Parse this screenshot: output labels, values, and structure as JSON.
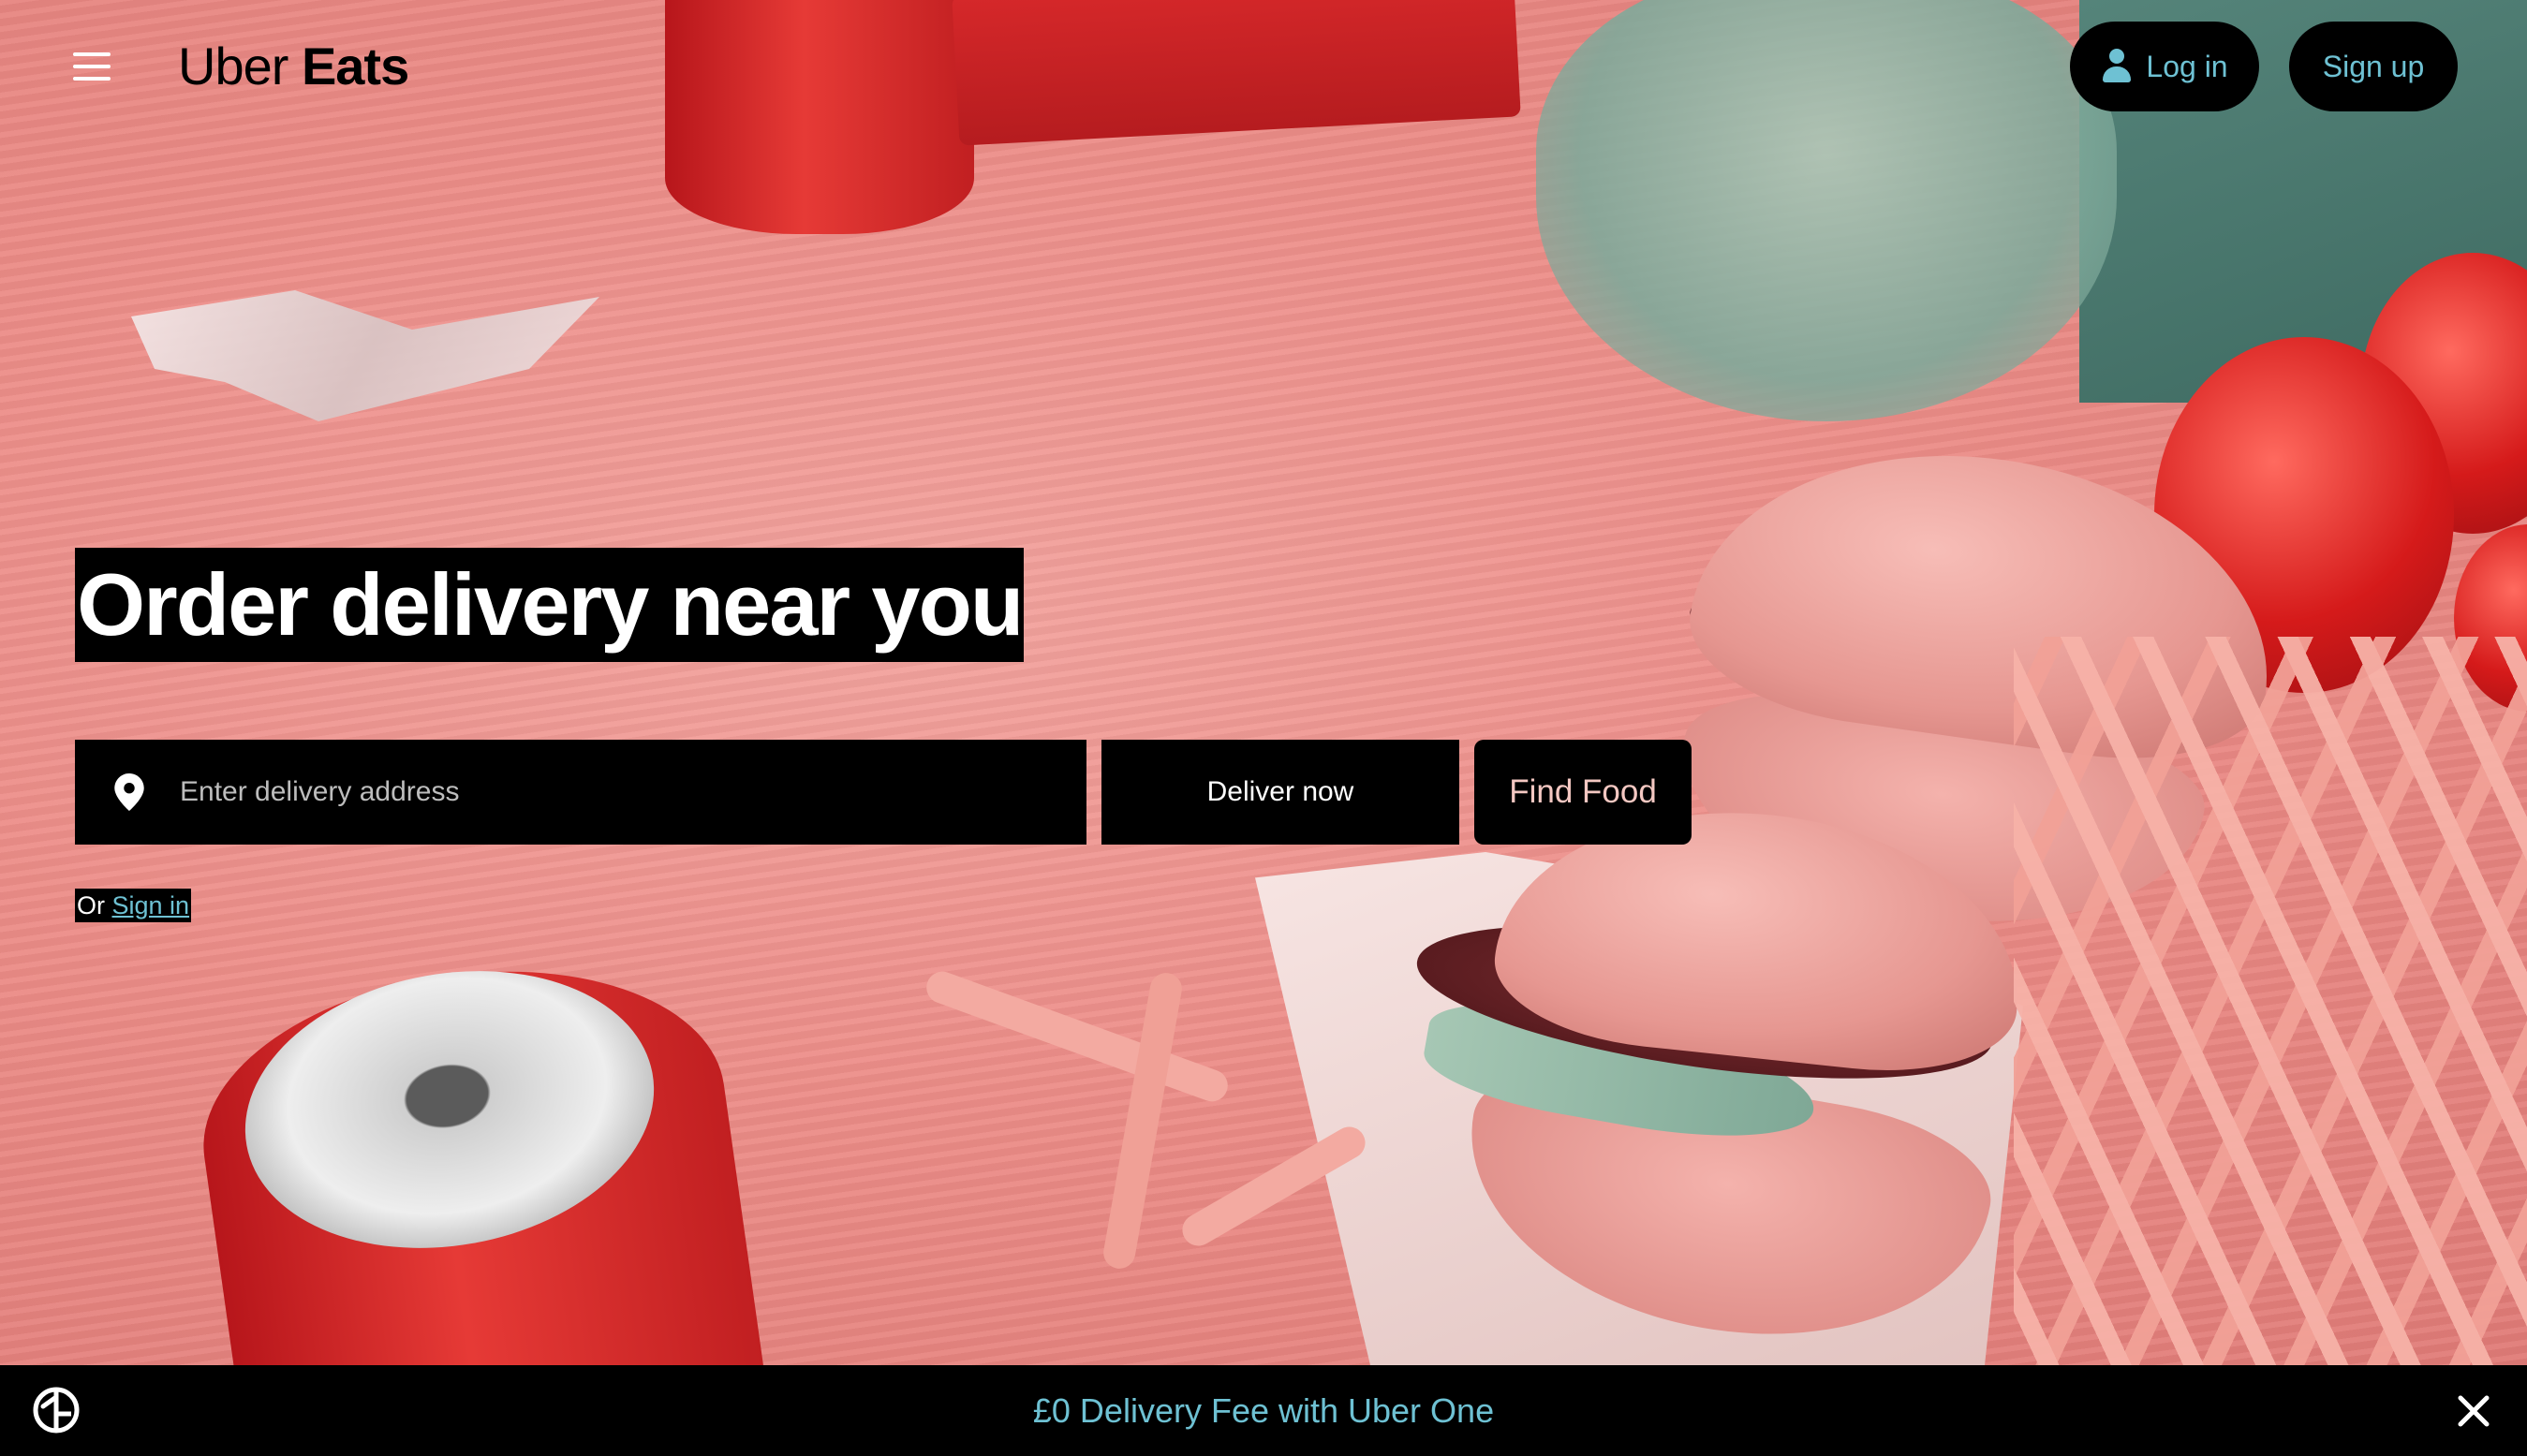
{
  "header": {
    "logo_light": "Uber ",
    "logo_bold": "Eats",
    "login_label": "Log in",
    "signup_label": "Sign up"
  },
  "hero": {
    "title": "Order delivery near you",
    "address_placeholder": "Enter delivery address",
    "address_value": "",
    "deliver_label": "Deliver now",
    "find_label": "Find Food",
    "or_text": "Or ",
    "signin_label": "Sign in"
  },
  "banner": {
    "text": "£0 Delivery Fee with Uber One"
  },
  "icons": {
    "menu": "menu-icon",
    "user": "user-icon",
    "location": "location-pin-icon",
    "uber_one": "uber-one-icon",
    "close": "close-icon"
  },
  "colors": {
    "accent": "#6ec1d3",
    "button_bg": "#000000",
    "background_tint": "#e9837f"
  }
}
